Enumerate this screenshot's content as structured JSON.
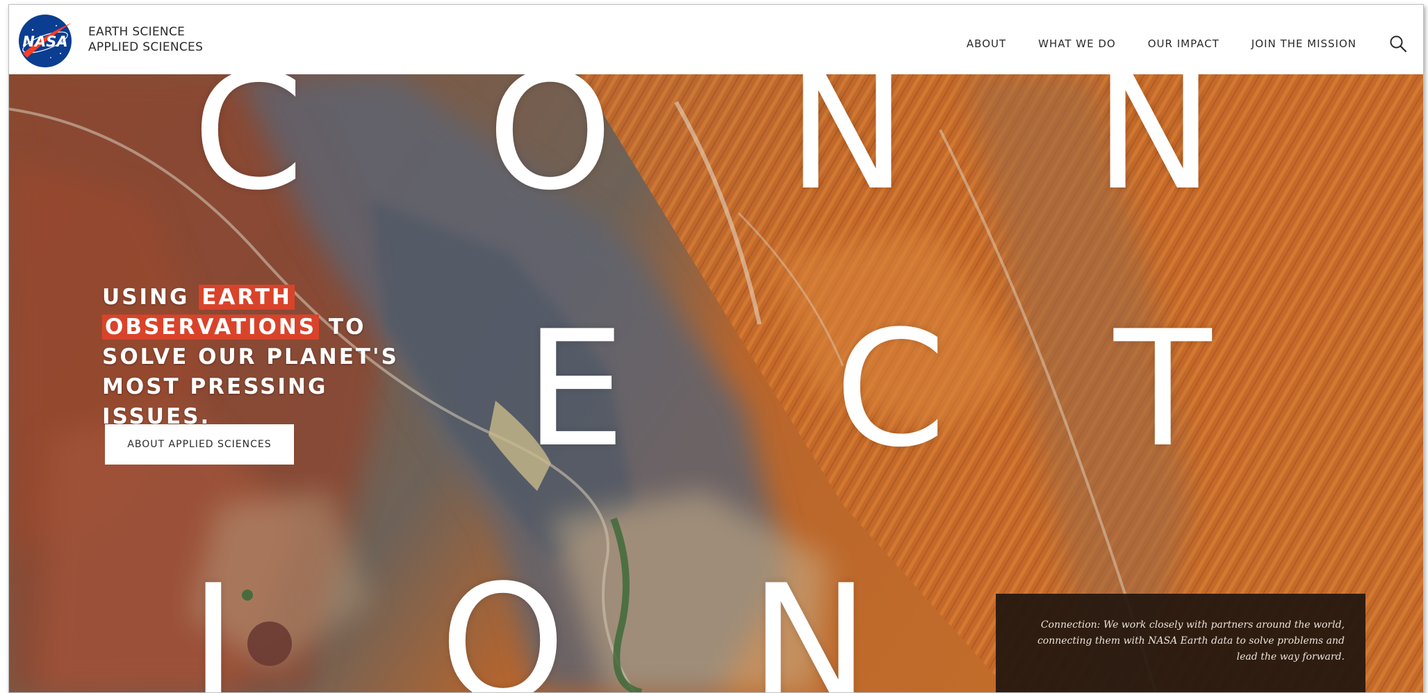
{
  "header": {
    "brand_line1": "EARTH SCIENCE",
    "brand_line2": "APPLIED SCIENCES",
    "logo_text": "NASA",
    "nav": [
      {
        "label": "ABOUT"
      },
      {
        "label": "WHAT WE DO"
      },
      {
        "label": "OUR IMPACT"
      },
      {
        "label": "JOIN THE MISSION"
      }
    ],
    "search_icon": "search-icon"
  },
  "hero": {
    "letters": [
      "C",
      "O",
      "N",
      "N",
      "E",
      "C",
      "T",
      "I",
      "O",
      "N"
    ],
    "tagline": {
      "part1": "USING ",
      "highlight1": "EARTH",
      "highlight2": "OBSERVATIONS",
      "part2": " TO SOLVE OUR PLANET'S MOST PRESSING ISSUES."
    },
    "button_label": "ABOUT APPLIED SCIENCES",
    "caption": "Connection: We work closely with partners around the world, connecting them with NASA Earth data to solve problems and lead the way forward."
  },
  "colors": {
    "highlight": "#d9432a",
    "nasa_blue": "#0b3d91",
    "nasa_red": "#fc3d21",
    "caption_bg": "#22160e"
  }
}
